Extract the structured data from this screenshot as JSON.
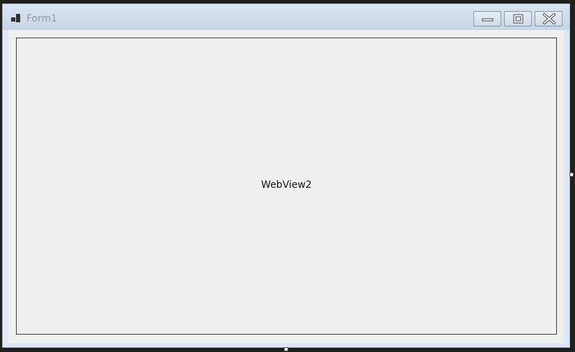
{
  "window": {
    "title": "Form1",
    "icons": {
      "app": "form-icon",
      "minimize": "minimize-icon",
      "maximize": "maximize-icon",
      "close": "close-icon"
    }
  },
  "content": {
    "webview_label": "WebView2"
  },
  "colors": {
    "titlebar": "#c7d5e7",
    "client": "#f0f0f0",
    "border": "#3c3c3c"
  }
}
